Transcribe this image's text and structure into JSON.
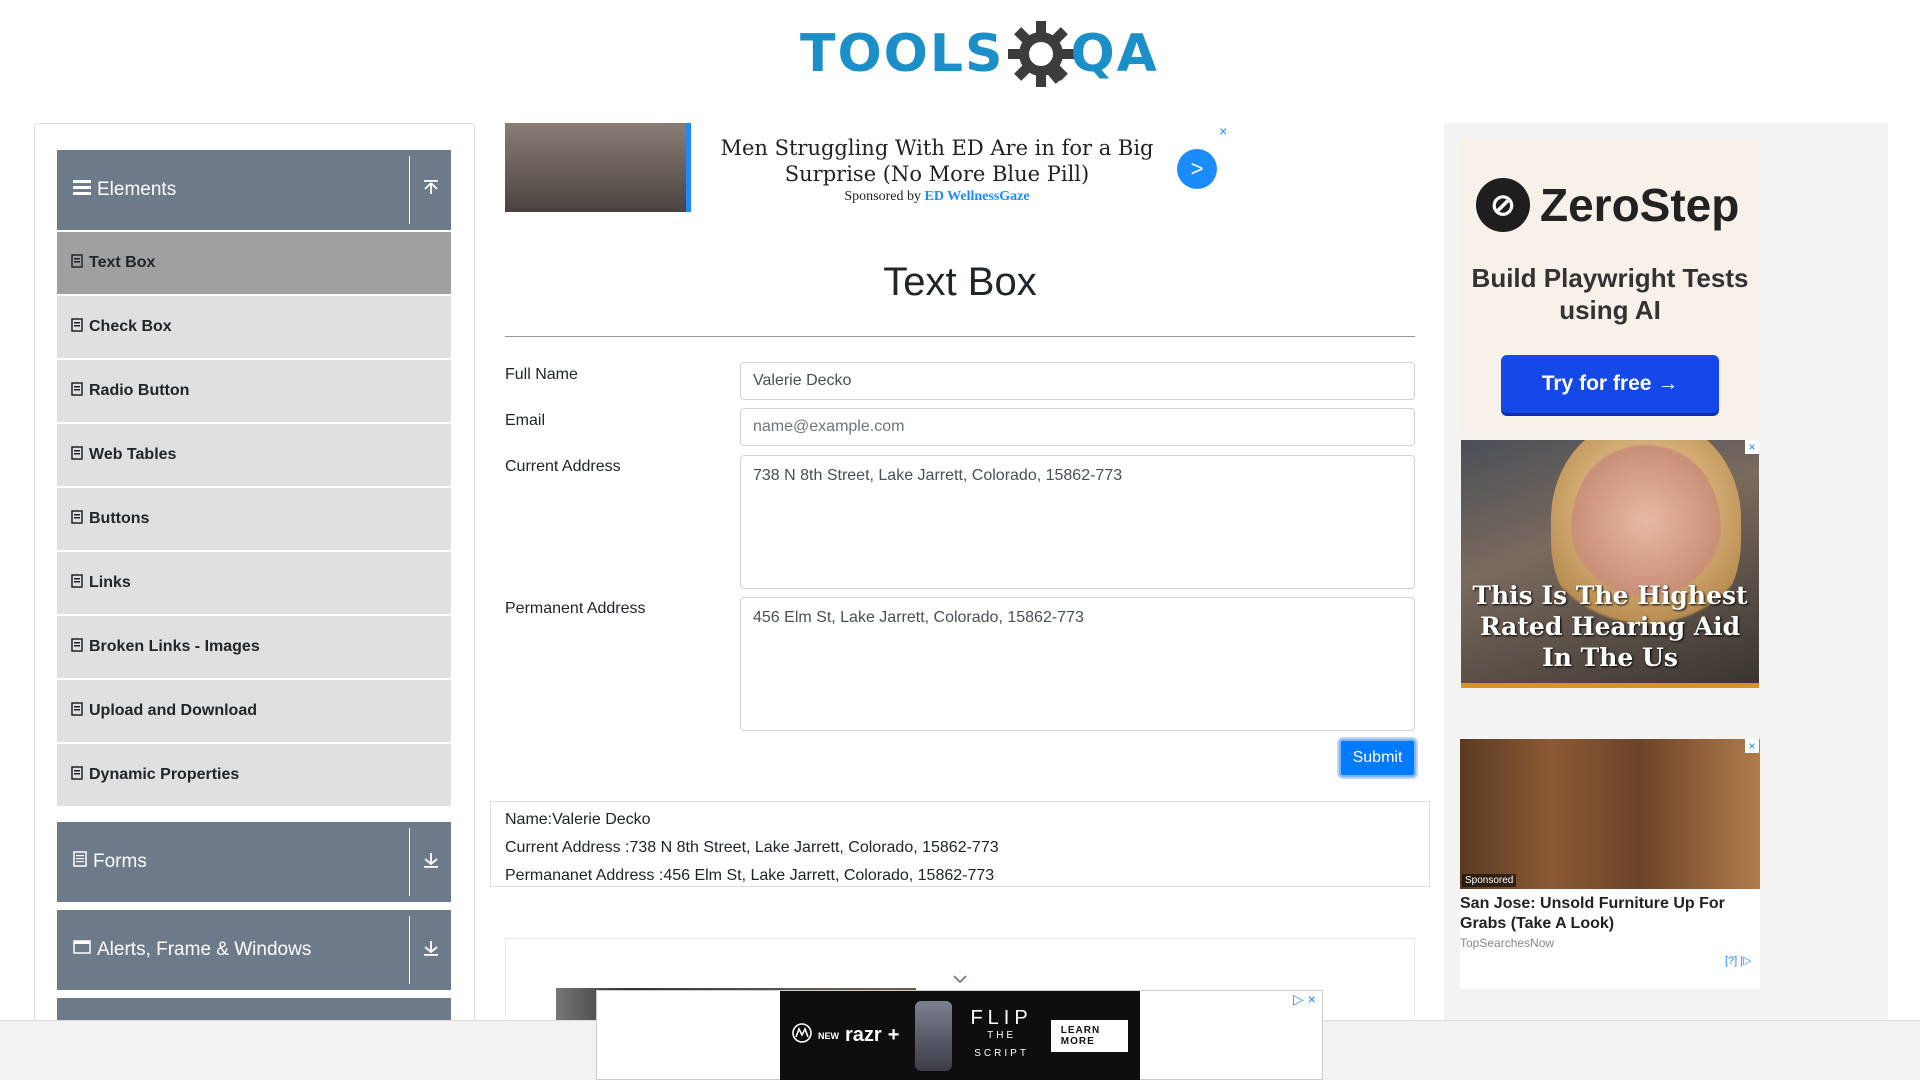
{
  "header": {
    "logo_part1": "TOOLS",
    "logo_part2": "QA"
  },
  "sidebar": {
    "groups": [
      {
        "label": "Elements",
        "items": [
          {
            "label": "Text Box"
          },
          {
            "label": "Check Box"
          },
          {
            "label": "Radio Button"
          },
          {
            "label": "Web Tables"
          },
          {
            "label": "Buttons"
          },
          {
            "label": "Links"
          },
          {
            "label": "Broken Links - Images"
          },
          {
            "label": "Upload and Download"
          },
          {
            "label": "Dynamic Properties"
          }
        ]
      },
      {
        "label": "Forms"
      },
      {
        "label": "Alerts, Frame & Windows"
      }
    ]
  },
  "top_ad": {
    "headline": "Men Struggling With ED Are in for a Big Surprise (No More Blue Pill)",
    "sponsored_prefix": "Sponsored by",
    "sponsor": "ED WellnessGaze",
    "arrow": ">",
    "close": "×"
  },
  "main": {
    "title": "Text Box",
    "form": {
      "full_name_label": "Full Name",
      "full_name_value": "Valerie Decko",
      "email_label": "Email",
      "email_placeholder": "name@example.com",
      "current_address_label": "Current Address",
      "current_address_value": "738 N 8th Street, Lake Jarrett, Colorado, 15862-773",
      "permanent_address_label": "Permanent Address",
      "permanent_address_value": "456 Elm St, Lake Jarrett, Colorado, 15862-773",
      "submit_label": "Submit"
    },
    "output": {
      "name": "Name:Valerie Decko",
      "current_address": "Current Address :738 N 8th Street, Lake Jarrett, Colorado, 15862-773",
      "permanent_address": "Permananet Address :456 Elm St, Lake Jarrett, Colorado, 15862-773"
    }
  },
  "right_ads": {
    "zerostep": {
      "brand": "ZeroStep",
      "tagline": "Build Playwright Tests using AI",
      "cta": "Try for free →"
    },
    "hearing": {
      "headline": "This Is The Highest Rated Hearing Aid In The Us"
    },
    "furniture": {
      "badge": "Sponsored",
      "headline": "San Jose: Unsold Furniture Up For Grabs (Take A Look)",
      "source": "TopSearchesNow",
      "adchoices": "[?] |▷"
    }
  },
  "bottom_ad": {
    "brand_new": "NEW",
    "brand": "razr",
    "brand_plus": "+",
    "flip": "FLIP",
    "script": "THE SCRIPT",
    "cta": "LEARN MORE",
    "close": "▷ ×"
  }
}
